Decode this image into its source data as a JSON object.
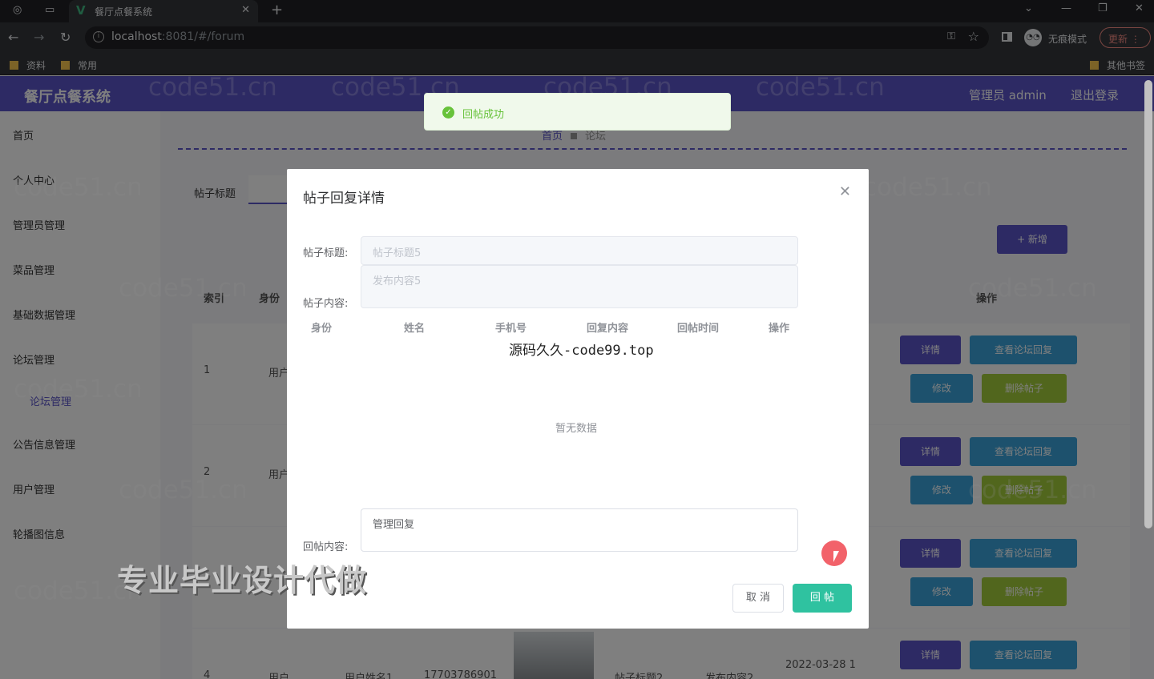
{
  "browser": {
    "tab_title": "餐厅点餐系统",
    "url_host": "localhost",
    "url_rest": ":8081/#/forum",
    "incognito_label": "无痕模式",
    "update_label": "更新",
    "bookmarks": [
      "资料",
      "常用"
    ],
    "other_bookmarks": "其他书签"
  },
  "header": {
    "brand": "餐厅点餐系统",
    "user": "管理员 admin",
    "logout": "退出登录"
  },
  "sidebar": {
    "items": [
      "首页",
      "个人中心",
      "管理员管理",
      "菜品管理",
      "基础数据管理",
      "论坛管理",
      "论坛管理",
      "公告信息管理",
      "用户管理",
      "轮播图信息"
    ]
  },
  "breadcrumb": {
    "home": "首页",
    "current": "论坛"
  },
  "search": {
    "label": "帖子标题"
  },
  "toolbar": {
    "add": "+ 新增"
  },
  "table": {
    "headers": [
      "索引",
      "身份",
      "操作"
    ],
    "rows": [
      {
        "index": "1",
        "identity": "用户"
      },
      {
        "index": "2",
        "identity": "用户"
      },
      {
        "index": "4",
        "identity": "用户",
        "name": "用户姓名1",
        "phone": "17703786901",
        "title": "帖子标题2",
        "content": "发布内容2",
        "time": "2022-03-28 1"
      }
    ],
    "actions": {
      "detail": "详情",
      "view_replies": "查看论坛回复",
      "edit": "修改",
      "delete": "删除帖子"
    }
  },
  "dialog": {
    "title": "帖子回复详情",
    "title_label": "帖子标题:",
    "title_value": "帖子标题5",
    "content_label": "帖子内容:",
    "content_value": "发布内容5",
    "reply_headers": [
      "身份",
      "姓名",
      "手机号",
      "回复内容",
      "回帖时间",
      "操作"
    ],
    "empty_text": "暂无数据",
    "reply_label": "回帖内容:",
    "reply_value": "管理回复",
    "cancel": "取 消",
    "submit": "回 帖"
  },
  "toast": {
    "message": "回帖成功"
  },
  "overlays": {
    "site_text": "源码久久-code99.top",
    "banner": "专业毕业设计代做",
    "watermark": "code51.cn"
  },
  "colors": {
    "primary": "#5a55c9",
    "success": "#67c23a",
    "submit": "#2fc2a0",
    "info": "#3aa3db",
    "warning": "#a3cd3b"
  }
}
